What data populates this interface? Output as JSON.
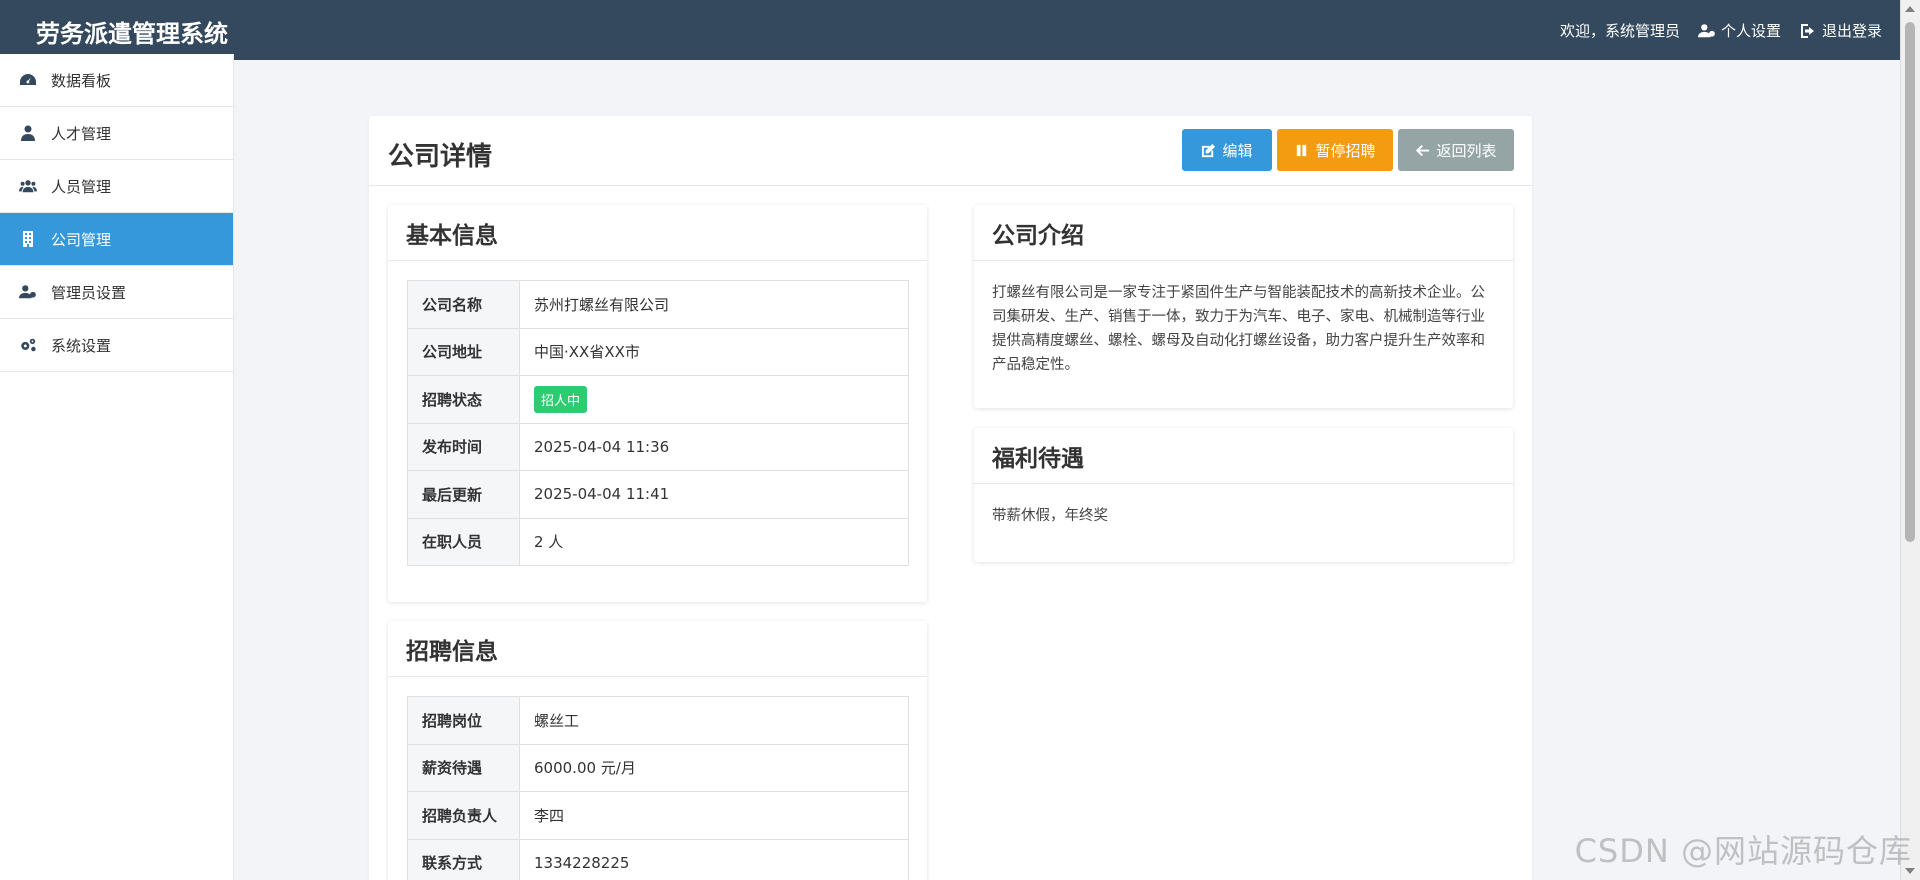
{
  "header": {
    "brand": "劳务派遣管理系统",
    "welcome": "欢迎，系统管理员",
    "profile_label": "个人设置",
    "logout_label": "退出登录"
  },
  "sidebar": {
    "items": [
      {
        "label": "数据看板",
        "icon": "dashboard-icon"
      },
      {
        "label": "人才管理",
        "icon": "user-tie-icon"
      },
      {
        "label": "人员管理",
        "icon": "users-icon"
      },
      {
        "label": "公司管理",
        "icon": "building-icon",
        "active": true
      },
      {
        "label": "管理员设置",
        "icon": "user-gear-icon"
      },
      {
        "label": "系统设置",
        "icon": "gears-icon"
      }
    ]
  },
  "page": {
    "title": "公司详情",
    "buttons": {
      "edit": "编辑",
      "pause": "暂停招聘",
      "back": "返回列表"
    }
  },
  "basic_info": {
    "title": "基本信息",
    "rows": [
      {
        "key": "公司名称",
        "value": "苏州打螺丝有限公司"
      },
      {
        "key": "公司地址",
        "value": "中国·XX省XX市"
      },
      {
        "key": "招聘状态",
        "value": "招人中",
        "badge": true
      },
      {
        "key": "发布时间",
        "value": "2025-04-04 11:36"
      },
      {
        "key": "最后更新",
        "value": "2025-04-04 11:41"
      },
      {
        "key": "在职人员",
        "value": "2 人"
      }
    ]
  },
  "recruit_info": {
    "title": "招聘信息",
    "rows": [
      {
        "key": "招聘岗位",
        "value": "螺丝工"
      },
      {
        "key": "薪资待遇",
        "value": "6000.00 元/月"
      },
      {
        "key": "招聘负责人",
        "value": "李四"
      },
      {
        "key": "联系方式",
        "value": "1334228225"
      }
    ]
  },
  "intro": {
    "title": "公司介绍",
    "text": "打螺丝有限公司是一家专注于紧固件生产与智能装配技术的高新技术企业。公司集研发、生产、销售于一体，致力于为汽车、电子、家电、机械制造等行业提供高精度螺丝、螺栓、螺母及自动化打螺丝设备，助力客户提升生产效率和产品稳定性。"
  },
  "benefits": {
    "title": "福利待遇",
    "text": "带薪休假，年终奖"
  },
  "watermark": "CSDN @网站源码仓库",
  "colors": {
    "header_bg": "#34495e",
    "accent": "#3498db",
    "warning": "#f39c12",
    "muted": "#95a5a6",
    "success": "#2ecc71"
  }
}
